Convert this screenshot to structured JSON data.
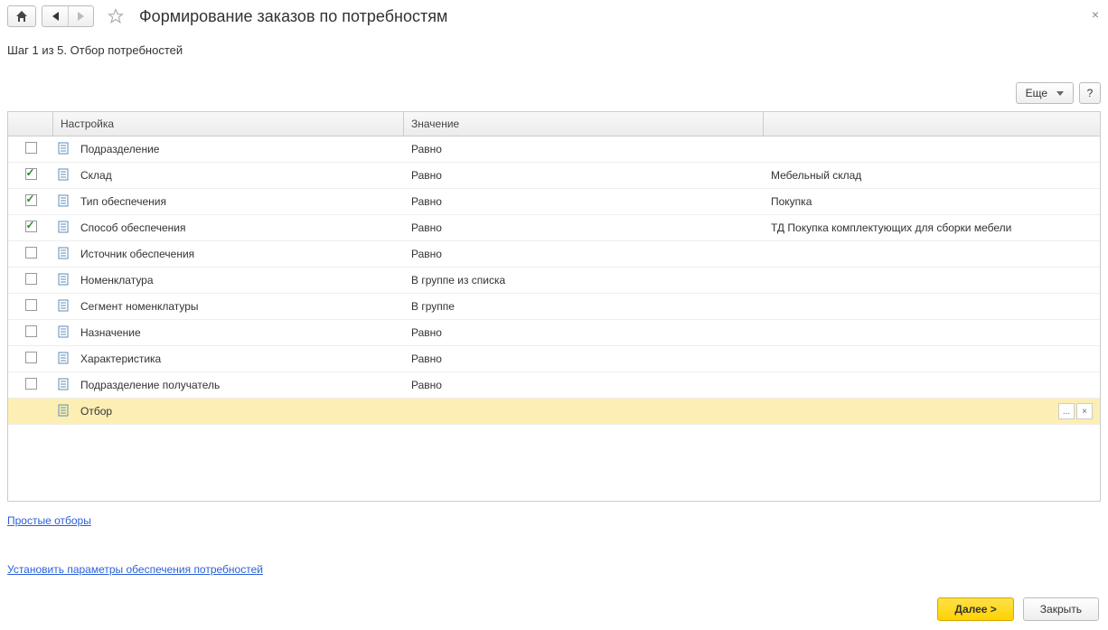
{
  "title": "Формирование заказов по потребностям",
  "subtitle": "Шаг 1 из 5. Отбор потребностей",
  "toolbar": {
    "more": "Еще",
    "help": "?"
  },
  "columns": {
    "setting": "Настройка",
    "value": "Значение"
  },
  "rows": [
    {
      "checked": false,
      "name": "Подразделение",
      "value": "Равно",
      "comp": ""
    },
    {
      "checked": true,
      "name": "Склад",
      "value": "Равно",
      "comp": "Мебельный склад"
    },
    {
      "checked": true,
      "name": "Тип обеспечения",
      "value": "Равно",
      "comp": "Покупка"
    },
    {
      "checked": true,
      "name": "Способ обеспечения",
      "value": "Равно",
      "comp": "ТД Покупка комплектующих для сборки мебели"
    },
    {
      "checked": false,
      "name": "Источник обеспечения",
      "value": "Равно",
      "comp": ""
    },
    {
      "checked": false,
      "name": "Номенклатура",
      "value": "В группе из списка",
      "comp": ""
    },
    {
      "checked": false,
      "name": "Сегмент номенклатуры",
      "value": "В группе",
      "comp": ""
    },
    {
      "checked": false,
      "name": "Назначение",
      "value": "Равно",
      "comp": ""
    },
    {
      "checked": false,
      "name": "Характеристика",
      "value": "Равно",
      "comp": ""
    },
    {
      "checked": false,
      "name": "Подразделение получатель",
      "value": "Равно",
      "comp": ""
    }
  ],
  "selected_row": {
    "name": "Отбор",
    "ellipsis": "...",
    "clear": "×"
  },
  "links": {
    "simple": "Простые отборы",
    "params": "Установить параметры обеспечения потребностей"
  },
  "footer": {
    "next": "Далее >",
    "close": "Закрыть"
  }
}
